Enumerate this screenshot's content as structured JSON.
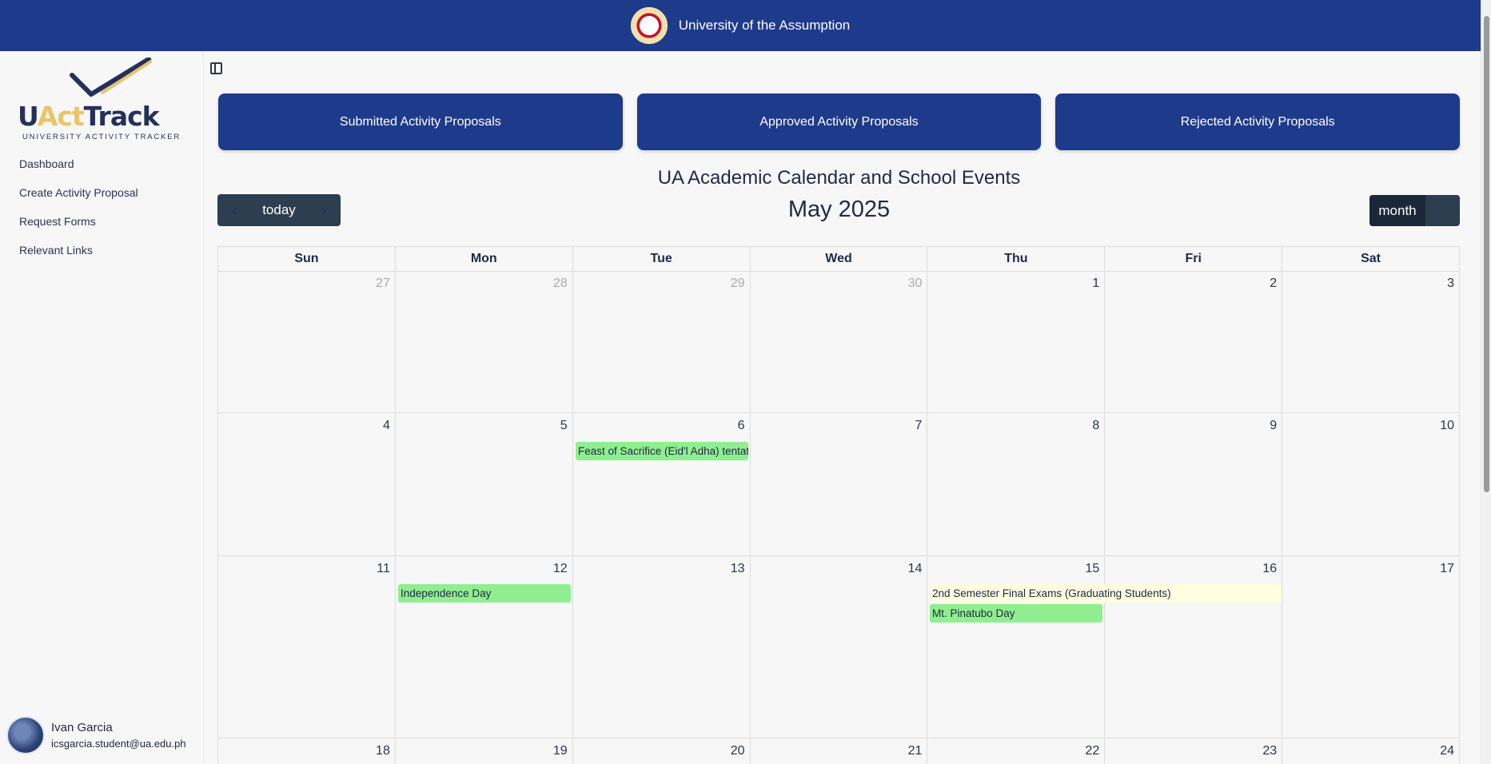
{
  "header": {
    "title": "University of the Assumption"
  },
  "sidebar": {
    "logo_part1": "U",
    "logo_part2": "Act",
    "logo_part3": "Track",
    "logo_tagline": "UNIVERSITY ACTIVITY TRACKER",
    "items": [
      {
        "label": "Dashboard"
      },
      {
        "label": "Create Activity Proposal"
      },
      {
        "label": "Request Forms"
      },
      {
        "label": "Relevant Links"
      }
    ],
    "user": {
      "name": "Ivan Garcia",
      "email": "icsgarcia.student@ua.edu.ph"
    }
  },
  "cards": [
    {
      "label": "Submitted Activity Proposals"
    },
    {
      "label": "Approved Activity Proposals"
    },
    {
      "label": "Rejected Activity Proposals"
    }
  ],
  "calendar": {
    "title": "UA Academic Calendar and School Events",
    "month": "May 2025",
    "today_label": "today",
    "prev_icon": "‹",
    "next_icon": "›",
    "view_label": "month",
    "weekdays": [
      "Sun",
      "Mon",
      "Tue",
      "Wed",
      "Thu",
      "Fri",
      "Sat"
    ],
    "weeks": [
      [
        "27",
        "28",
        "29",
        "30",
        "1",
        "2",
        "3"
      ],
      [
        "4",
        "5",
        "6",
        "7",
        "8",
        "9",
        "10"
      ],
      [
        "11",
        "12",
        "13",
        "14",
        "15",
        "16",
        "17"
      ],
      [
        "18",
        "19",
        "20",
        "21",
        "22",
        "23",
        "24"
      ]
    ],
    "events": {
      "eid": "Feast of Sacrifice (Eid'l Adha) tentative",
      "independence": "Independence Day",
      "finals": "2nd Semester Final Exams (Graduating Students)",
      "pinatubo": "Mt. Pinatubo Day"
    },
    "colors": {
      "holiday": "#90ee90",
      "exam": "#fefee0"
    }
  }
}
